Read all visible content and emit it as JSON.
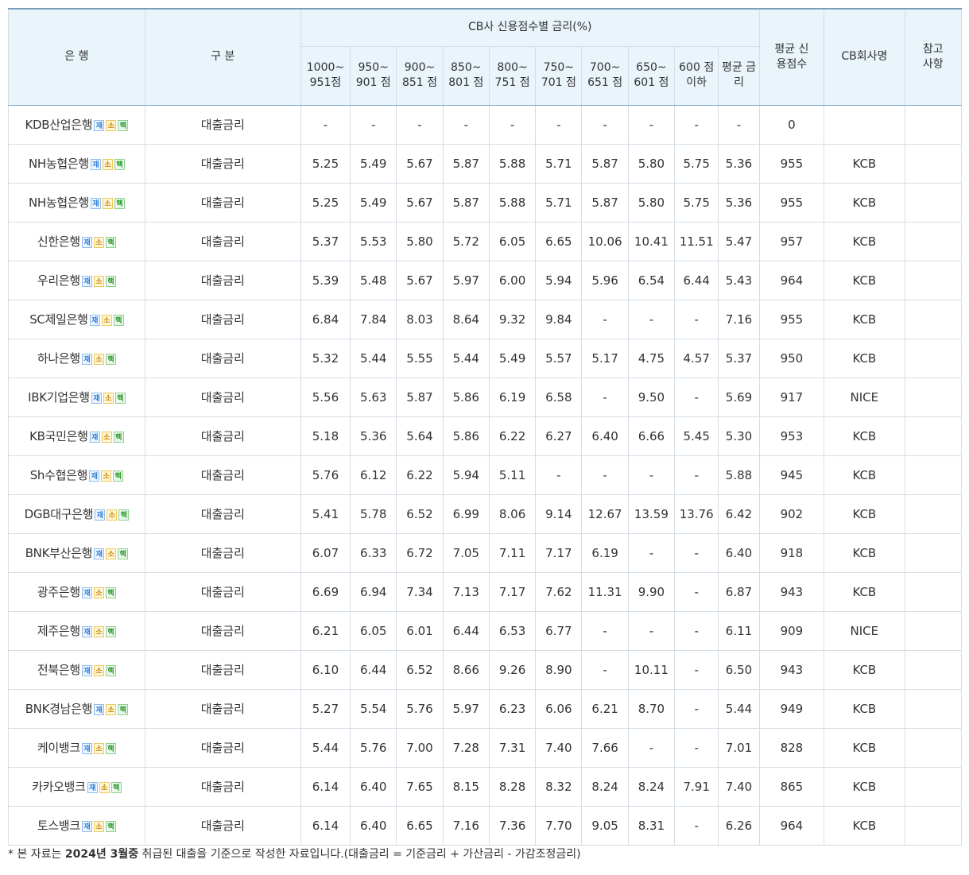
{
  "header": {
    "bank": "은 행",
    "type": "구 분",
    "group": "CB사 신용점수별 금리(%)",
    "avg_score": "평균 신용점수",
    "cb_name": "CB회사명",
    "ref": "참고 사항",
    "score_cols": [
      "1000~ 951점",
      "950~ 901 점",
      "900~ 851 점",
      "850~ 801 점",
      "800~ 751 점",
      "750~ 701 점",
      "700~ 651 점",
      "650~ 601 점",
      "600 점 이하",
      "평균 금리"
    ]
  },
  "badges": [
    "재",
    "소",
    "핵"
  ],
  "rows": [
    {
      "bank": "KDB산업은행",
      "type": "대출금리",
      "rates": [
        "-",
        "-",
        "-",
        "-",
        "-",
        "-",
        "-",
        "-",
        "-",
        "-"
      ],
      "avg_score": "0",
      "cb": "",
      "ref": ""
    },
    {
      "bank": "NH농협은행",
      "type": "대출금리",
      "rates": [
        "5.25",
        "5.49",
        "5.67",
        "5.87",
        "5.88",
        "5.71",
        "5.87",
        "5.80",
        "5.75",
        "5.36"
      ],
      "avg_score": "955",
      "cb": "KCB",
      "ref": ""
    },
    {
      "bank": "NH농협은행",
      "type": "대출금리",
      "rates": [
        "5.25",
        "5.49",
        "5.67",
        "5.87",
        "5.88",
        "5.71",
        "5.87",
        "5.80",
        "5.75",
        "5.36"
      ],
      "avg_score": "955",
      "cb": "KCB",
      "ref": ""
    },
    {
      "bank": "신한은행",
      "type": "대출금리",
      "rates": [
        "5.37",
        "5.53",
        "5.80",
        "5.72",
        "6.05",
        "6.65",
        "10.06",
        "10.41",
        "11.51",
        "5.47"
      ],
      "avg_score": "957",
      "cb": "KCB",
      "ref": ""
    },
    {
      "bank": "우리은행",
      "type": "대출금리",
      "rates": [
        "5.39",
        "5.48",
        "5.67",
        "5.97",
        "6.00",
        "5.94",
        "5.96",
        "6.54",
        "6.44",
        "5.43"
      ],
      "avg_score": "964",
      "cb": "KCB",
      "ref": ""
    },
    {
      "bank": "SC제일은행",
      "type": "대출금리",
      "rates": [
        "6.84",
        "7.84",
        "8.03",
        "8.64",
        "9.32",
        "9.84",
        "-",
        "-",
        "-",
        "7.16"
      ],
      "avg_score": "955",
      "cb": "KCB",
      "ref": ""
    },
    {
      "bank": "하나은행",
      "type": "대출금리",
      "rates": [
        "5.32",
        "5.44",
        "5.55",
        "5.44",
        "5.49",
        "5.57",
        "5.17",
        "4.75",
        "4.57",
        "5.37"
      ],
      "avg_score": "950",
      "cb": "KCB",
      "ref": ""
    },
    {
      "bank": "IBK기업은행",
      "type": "대출금리",
      "rates": [
        "5.56",
        "5.63",
        "5.87",
        "5.86",
        "6.19",
        "6.58",
        "-",
        "9.50",
        "-",
        "5.69"
      ],
      "avg_score": "917",
      "cb": "NICE",
      "ref": ""
    },
    {
      "bank": "KB국민은행",
      "type": "대출금리",
      "rates": [
        "5.18",
        "5.36",
        "5.64",
        "5.86",
        "6.22",
        "6.27",
        "6.40",
        "6.66",
        "5.45",
        "5.30"
      ],
      "avg_score": "953",
      "cb": "KCB",
      "ref": ""
    },
    {
      "bank": "Sh수협은행",
      "type": "대출금리",
      "rates": [
        "5.76",
        "6.12",
        "6.22",
        "5.94",
        "5.11",
        "-",
        "-",
        "-",
        "-",
        "5.88"
      ],
      "avg_score": "945",
      "cb": "KCB",
      "ref": ""
    },
    {
      "bank": "DGB대구은행",
      "type": "대출금리",
      "rates": [
        "5.41",
        "5.78",
        "6.52",
        "6.99",
        "8.06",
        "9.14",
        "12.67",
        "13.59",
        "13.76",
        "6.42"
      ],
      "avg_score": "902",
      "cb": "KCB",
      "ref": ""
    },
    {
      "bank": "BNK부산은행",
      "type": "대출금리",
      "rates": [
        "6.07",
        "6.33",
        "6.72",
        "7.05",
        "7.11",
        "7.17",
        "6.19",
        "-",
        "-",
        "6.40"
      ],
      "avg_score": "918",
      "cb": "KCB",
      "ref": ""
    },
    {
      "bank": "광주은행",
      "type": "대출금리",
      "rates": [
        "6.69",
        "6.94",
        "7.34",
        "7.13",
        "7.17",
        "7.62",
        "11.31",
        "9.90",
        "-",
        "6.87"
      ],
      "avg_score": "943",
      "cb": "KCB",
      "ref": ""
    },
    {
      "bank": "제주은행",
      "type": "대출금리",
      "rates": [
        "6.21",
        "6.05",
        "6.01",
        "6.44",
        "6.53",
        "6.77",
        "-",
        "-",
        "-",
        "6.11"
      ],
      "avg_score": "909",
      "cb": "NICE",
      "ref": ""
    },
    {
      "bank": "전북은행",
      "type": "대출금리",
      "rates": [
        "6.10",
        "6.44",
        "6.52",
        "8.66",
        "9.26",
        "8.90",
        "-",
        "10.11",
        "-",
        "6.50"
      ],
      "avg_score": "943",
      "cb": "KCB",
      "ref": ""
    },
    {
      "bank": "BNK경남은행",
      "type": "대출금리",
      "rates": [
        "5.27",
        "5.54",
        "5.76",
        "5.97",
        "6.23",
        "6.06",
        "6.21",
        "8.70",
        "-",
        "5.44"
      ],
      "avg_score": "949",
      "cb": "KCB",
      "ref": ""
    },
    {
      "bank": "케이뱅크",
      "type": "대출금리",
      "rates": [
        "5.44",
        "5.76",
        "7.00",
        "7.28",
        "7.31",
        "7.40",
        "7.66",
        "-",
        "-",
        "7.01"
      ],
      "avg_score": "828",
      "cb": "KCB",
      "ref": ""
    },
    {
      "bank": "카카오뱅크",
      "type": "대출금리",
      "rates": [
        "6.14",
        "6.40",
        "7.65",
        "8.15",
        "8.28",
        "8.32",
        "8.24",
        "8.24",
        "7.91",
        "7.40"
      ],
      "avg_score": "865",
      "cb": "KCB",
      "ref": ""
    },
    {
      "bank": "토스뱅크",
      "type": "대출금리",
      "rates": [
        "6.14",
        "6.40",
        "6.65",
        "7.16",
        "7.36",
        "7.70",
        "9.05",
        "8.31",
        "-",
        "6.26"
      ],
      "avg_score": "964",
      "cb": "KCB",
      "ref": ""
    }
  ],
  "footnote": {
    "prefix": "* 본 자료는 ",
    "emphasis": "2024년 3월중",
    "suffix": " 취급된 대출을 기준으로 작성한 자료입니다.(대출금리 = 기준금리 + 가산금리 - 가감조정금리)"
  }
}
